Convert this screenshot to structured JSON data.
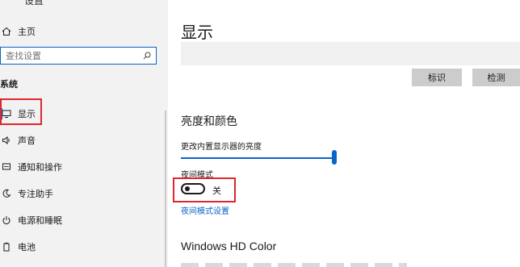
{
  "sidebar": {
    "window_title_fragment": "设置",
    "home_label": "主页",
    "search_placeholder": "查找设置",
    "section_label": "系统",
    "items": [
      {
        "label": "显示",
        "icon": "monitor-icon",
        "selected": true
      },
      {
        "label": "声音",
        "icon": "speaker-icon"
      },
      {
        "label": "通知和操作",
        "icon": "notification-icon"
      },
      {
        "label": "专注助手",
        "icon": "moon-icon"
      },
      {
        "label": "电源和睡眠",
        "icon": "power-icon"
      },
      {
        "label": "电池",
        "icon": "battery-icon"
      }
    ]
  },
  "main": {
    "title": "显示",
    "identify_label": "标识",
    "detect_label": "检测",
    "brightness_section": "亮度和颜色",
    "brightness_label": "更改内置显示器的亮度",
    "brightness_value": 100,
    "night_light_label": "夜间模式",
    "night_light_state": "关",
    "night_light_settings_link": "夜间模式设置",
    "hd_color_section": "Windows HD Color"
  },
  "colors": {
    "accent": "#0a63c9",
    "highlight_box": "#e0262b",
    "sidebar_bg": "#f2f2f2"
  }
}
